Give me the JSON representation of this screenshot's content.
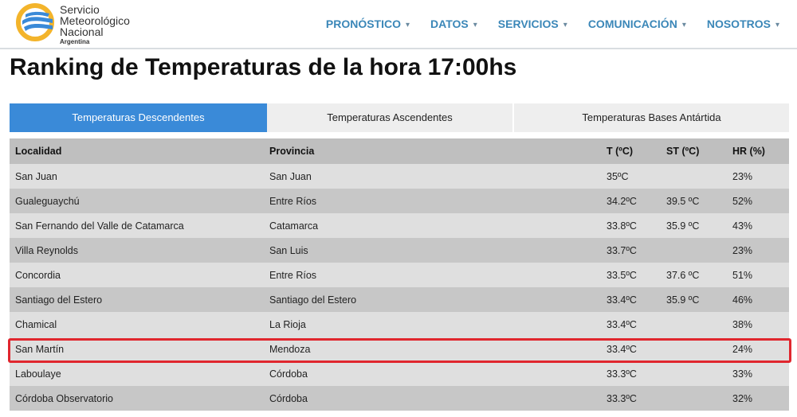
{
  "header": {
    "logo": {
      "line1": "Servicio",
      "line2": "Meteorológico",
      "line3": "Nacional",
      "line4": "Argentina",
      "colors": {
        "blue": "#3a8ad8",
        "yellow": "#f3b42b"
      }
    },
    "nav": [
      {
        "label": "PRONÓSTICO",
        "caret": "▾"
      },
      {
        "label": "DATOS",
        "caret": "▾"
      },
      {
        "label": "SERVICIOS",
        "caret": "▾"
      },
      {
        "label": "COMUNICACIÓN",
        "caret": "▾"
      },
      {
        "label": "NOSOTROS",
        "caret": "▾"
      }
    ]
  },
  "page_title": "Ranking de Temperaturas de la hora 17:00hs",
  "tabs": [
    {
      "label": "Temperaturas Descendentes",
      "active": true
    },
    {
      "label": "Temperaturas Ascendentes",
      "active": false
    },
    {
      "label": "Temperaturas Bases Antártida",
      "active": false
    }
  ],
  "table": {
    "headers": [
      "Localidad",
      "Provincia",
      "T (ºC)",
      "ST (ºC)",
      "HR (%)"
    ],
    "rows": [
      {
        "localidad": "San Juan",
        "provincia": "San Juan",
        "t": "35ºC",
        "st": "",
        "hr": "23%"
      },
      {
        "localidad": "Gualeguaychú",
        "provincia": "Entre Ríos",
        "t": "34.2ºC",
        "st": "39.5 ºC",
        "hr": "52%"
      },
      {
        "localidad": "San Fernando del Valle de Catamarca",
        "provincia": "Catamarca",
        "t": "33.8ºC",
        "st": "35.9 ºC",
        "hr": "43%"
      },
      {
        "localidad": "Villa Reynolds",
        "provincia": "San Luis",
        "t": "33.7ºC",
        "st": "",
        "hr": "23%"
      },
      {
        "localidad": "Concordia",
        "provincia": "Entre Ríos",
        "t": "33.5ºC",
        "st": "37.6 ºC",
        "hr": "51%"
      },
      {
        "localidad": "Santiago del Estero",
        "provincia": "Santiago del Estero",
        "t": "33.4ºC",
        "st": "35.9 ºC",
        "hr": "46%"
      },
      {
        "localidad": "Chamical",
        "provincia": "La Rioja",
        "t": "33.4ºC",
        "st": "",
        "hr": "38%"
      },
      {
        "localidad": "San Martín",
        "provincia": "Mendoza",
        "t": "33.4ºC",
        "st": "",
        "hr": "24%",
        "highlighted": true
      },
      {
        "localidad": "Laboulaye",
        "provincia": "Córdoba",
        "t": "33.3ºC",
        "st": "",
        "hr": "33%"
      },
      {
        "localidad": "Córdoba Observatorio",
        "provincia": "Córdoba",
        "t": "33.3ºC",
        "st": "",
        "hr": "32%"
      }
    ]
  },
  "colors": {
    "accent_blue": "#3a8ad8",
    "nav_text": "#3b87b8",
    "highlight_border": "#e0262e",
    "row_light": "#dfdfdf",
    "row_dark": "#c7c7c7",
    "header_bg": "#bfbfbf"
  }
}
